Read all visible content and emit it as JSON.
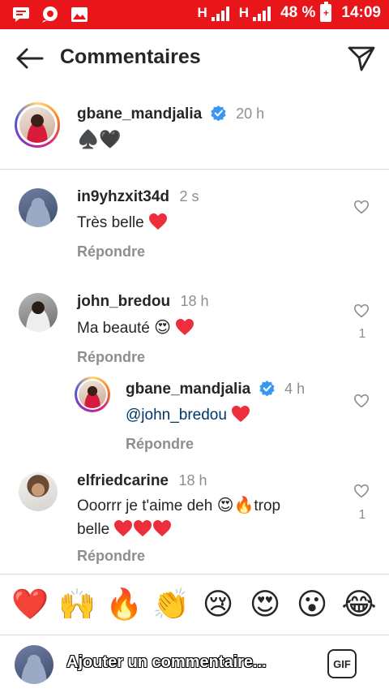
{
  "status_bar": {
    "network_1": "H",
    "network_2": "H",
    "battery": "48 %",
    "time": "14:09",
    "left_icons": [
      "message-icon",
      "location-chat-icon",
      "image-icon"
    ]
  },
  "header": {
    "title": "Commentaires"
  },
  "post": {
    "username": "gbane_mandjalia",
    "time": "20 h",
    "caption": "♠️🖤"
  },
  "comments": [
    {
      "username": "in9yhzxit34d",
      "time": "2 s",
      "text": "Très belle",
      "reply_label": "Répondre",
      "likes": ""
    },
    {
      "username": "john_bredou",
      "time": "18 h",
      "text": "Ma beauté",
      "reply_label": "Répondre",
      "likes": "1"
    },
    {
      "username": "gbane_mandjalia",
      "time": "4 h",
      "mention": "@john_bredou",
      "reply_label": "Répondre",
      "likes": ""
    },
    {
      "username": "elfriedcarine",
      "time": "18 h",
      "text_line1": "Ooorrr je t'aime deh",
      "text_line1b": "trop",
      "text_line2": "belle",
      "reply_label": "Répondre",
      "likes": "1"
    }
  ],
  "emoji_bar": [
    "❤️",
    "🙌",
    "🔥",
    "👏",
    "😢",
    "😍",
    "😮",
    "😂"
  ],
  "composer": {
    "placeholder": "Ajouter un commentaire...",
    "gif_label": "GIF"
  },
  "colors": {
    "status_bar": "#e8161b",
    "verified": "#3897f0",
    "heart": "#ed2e3d",
    "mention": "#00376b",
    "secondary_text": "#8e8e8e"
  }
}
